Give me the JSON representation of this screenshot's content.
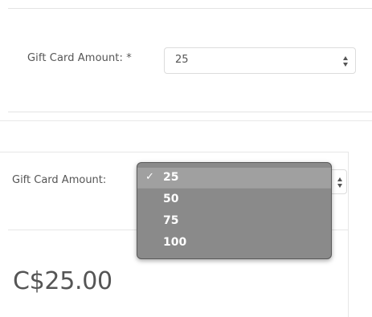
{
  "top_form": {
    "label": "Gift Card Amount: *",
    "selected_value": "25"
  },
  "bottom_form": {
    "label": "Gift Card Amount:",
    "price": "C$25.00"
  },
  "dropdown": {
    "check_glyph": "✓",
    "options": [
      "25",
      "50",
      "75",
      "100"
    ],
    "selected_index": 0
  },
  "icons": {
    "stepper": "up-down-chevron-icon",
    "check": "checkmark-icon"
  }
}
